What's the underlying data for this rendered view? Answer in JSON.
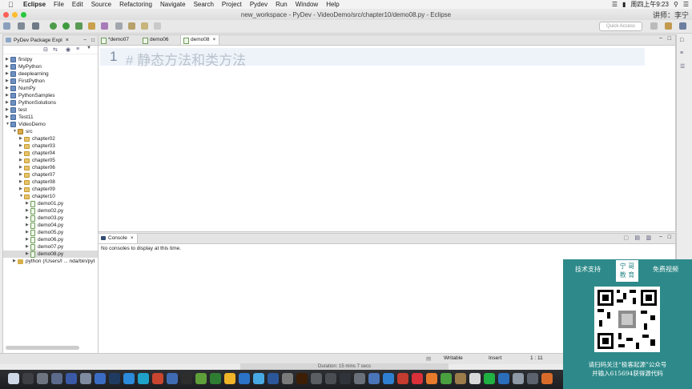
{
  "menubar": {
    "app_name": "Eclipse",
    "items": [
      "File",
      "Edit",
      "Source",
      "Refactoring",
      "Navigate",
      "Search",
      "Project",
      "Pydev",
      "Run",
      "Window",
      "Help"
    ],
    "clock": "周四上午9:23"
  },
  "window": {
    "title": "new_workspace - PyDev - VideoDemo/src/chapter10/demo08.py - Eclipse",
    "user_label": "讲师：李宁"
  },
  "toolbar": {
    "quick_access_placeholder": "Quick Access"
  },
  "package_explorer": {
    "tab_label": "PyDev Package Expl",
    "projects": [
      "firstpy",
      "MyPython",
      "deeplearning",
      "FirstPython",
      "NumPy",
      "PythonSamples",
      "PythonSolutions",
      "test",
      "Test11",
      "VideoDemo"
    ],
    "src_label": "src",
    "chapters": [
      "chapter02",
      "chapter03",
      "chapter04",
      "chapter05",
      "chapter06",
      "chapter07",
      "chapter08",
      "chapter09",
      "chapter10"
    ],
    "files": [
      "demo01.py",
      "demo02.py",
      "demo03.py",
      "demo04.py",
      "demo05.py",
      "demo06.py",
      "demo07.py",
      "demo08.py"
    ],
    "interpreter": "python  (/Users/l ... nda/bin/pyt"
  },
  "editor": {
    "tabs": [
      "*demo07",
      "demo06",
      "demo08"
    ],
    "active_tab": "demo08",
    "line_number": "1",
    "code": "# 静态方法和类方法"
  },
  "console": {
    "tab_label": "Console",
    "message": "No consoles to display at this time."
  },
  "statusbar": {
    "mode": "Writable",
    "insert": "Insert",
    "position": "1 : 11"
  },
  "duration": "Duration: 15 mins 7 secs",
  "ad": {
    "left_text": "技术支持",
    "logo_line1": "宁 哥",
    "logo_line2": "教 育",
    "right_text": "免费视频",
    "caption1": "请扫码关注“极客起源”公众号",
    "caption2": "并输入615694获得源代码"
  }
}
